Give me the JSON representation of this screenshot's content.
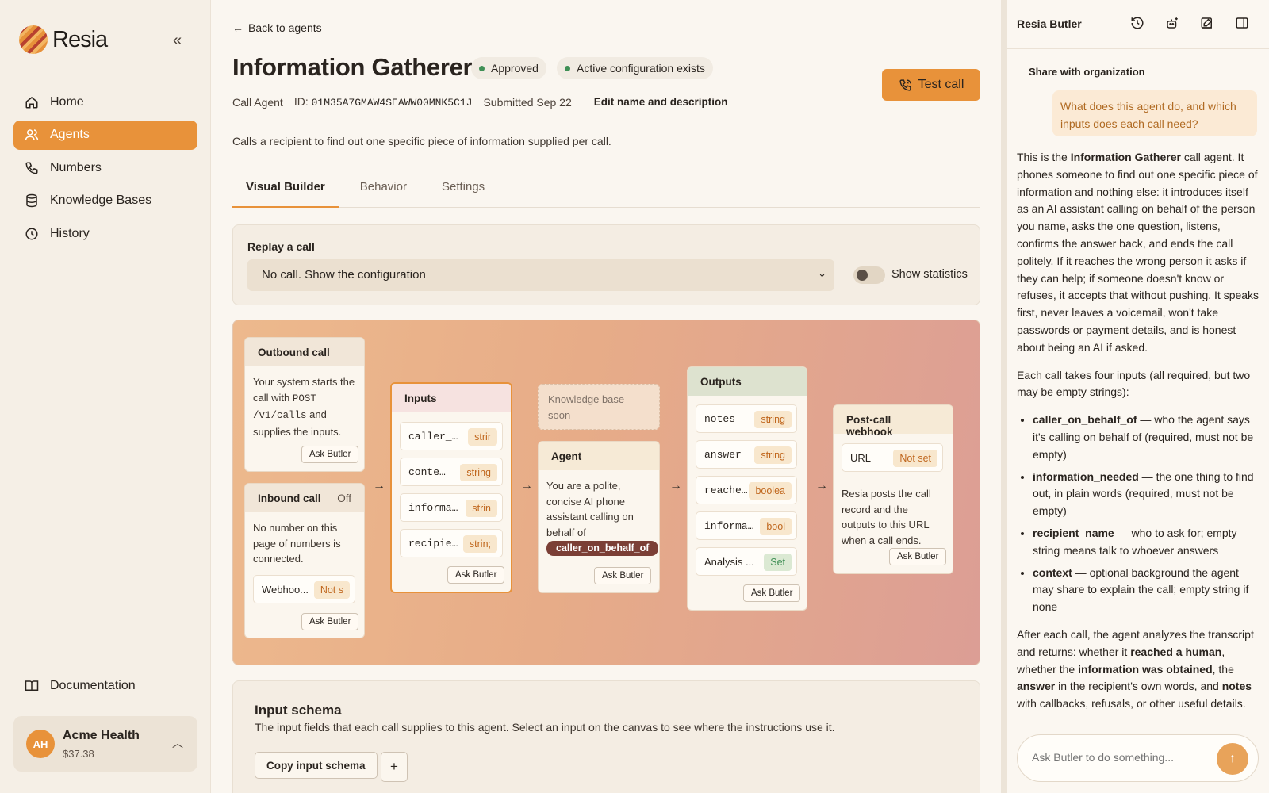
{
  "brand": {
    "name": "Resia"
  },
  "sidebar": {
    "items": [
      {
        "label": "Home",
        "active": false
      },
      {
        "label": "Agents",
        "active": true
      },
      {
        "label": "Numbers",
        "active": false
      },
      {
        "label": "Knowledge Bases",
        "active": false
      },
      {
        "label": "History",
        "active": false
      }
    ],
    "documentation": "Documentation",
    "account": {
      "initials": "AH",
      "name": "Acme Health",
      "balance": "$37.38"
    }
  },
  "header": {
    "back": "Back to agents",
    "title": "Information Gatherer",
    "badges": [
      "Approved",
      "Active configuration exists"
    ],
    "meta": {
      "type": "Call Agent",
      "id_label": "ID:",
      "id": "01M35A7GMAW4SEAWW00MNK5C1J",
      "submitted": "Submitted Sep 22",
      "edit": "Edit name and description"
    },
    "test_call": "Test call",
    "description": "Calls a recipient to find out one specific piece of information supplied per call."
  },
  "tabs": [
    "Visual Builder",
    "Behavior",
    "Settings"
  ],
  "replay": {
    "label": "Replay a call",
    "selected": "No call. Show the configuration",
    "toggle_label": "Show statistics"
  },
  "canvas": {
    "ask": "Ask Butler",
    "outbound": {
      "title": "Outbound call",
      "text_1": "Your system starts the call with ",
      "code_1": "POST",
      "code_2": "/v1/calls",
      "text_2": " and supplies the inputs."
    },
    "inbound": {
      "title": "Inbound call",
      "status": "Off",
      "text": "No number on this page of numbers is connected.",
      "field_name": "Webhoo...",
      "field_type": "Not s"
    },
    "inputs": {
      "title": "Inputs",
      "fields": [
        {
          "name": "caller_…",
          "type": "strir"
        },
        {
          "name": "conte…",
          "type": "string"
        },
        {
          "name": "informa…",
          "type": "strin"
        },
        {
          "name": "recipie…",
          "type": "strin;"
        }
      ]
    },
    "kb": {
      "text": "Knowledge base — soon"
    },
    "agent": {
      "title": "Agent",
      "text": "You are a polite, concise AI phone assistant calling on behalf of",
      "var": "caller_on_behalf_of"
    },
    "outputs": {
      "title": "Outputs",
      "fields": [
        {
          "name": "notes",
          "type": "string"
        },
        {
          "name": "answer",
          "type": "string"
        },
        {
          "name": "reache…",
          "type": "boolea"
        },
        {
          "name": "informa…",
          "type": "bool"
        },
        {
          "name": "Analysis ...",
          "type": "Set"
        }
      ]
    },
    "webhook": {
      "title": "Post-call webhook",
      "field_name": "URL",
      "field_type": "Not set",
      "text": "Resia posts the call record and the outputs to this URL when a call ends."
    }
  },
  "schema": {
    "title": "Input schema",
    "desc": "The input fields that each call supplies to this agent. Select an input on the canvas to see where the instructions use it.",
    "copy": "Copy input schema",
    "plus": "+"
  },
  "butler": {
    "title": "Resia Butler",
    "share": "Share with organization",
    "question": "What does this agent do, and which inputs does each call need?",
    "p1": {
      "a": "This is the ",
      "b": "Information Gatherer",
      "c": " call agent. It phones someone to find out one specific piece of information and nothing else: it introduces itself as an AI assistant calling on behalf of the person you name, asks the one question, listens, confirms the answer back, and ends the call politely. If it reaches the wrong person it asks if they can help; if someone doesn't know or refuses, it accepts that without pushing. It speaks first, never leaves a voicemail, won't take passwords or payment details, and is honest about being an AI if asked."
    },
    "p2": "Each call takes four inputs (all required, but two may be empty strings):",
    "bullets": [
      {
        "term": "caller_on_behalf_of",
        "text": " — who the agent says it's calling on behalf of (required, must not be empty)"
      },
      {
        "term": "information_needed",
        "text": " — the one thing to find out, in plain words (required, must not be empty)"
      },
      {
        "term": "recipient_name",
        "text": " — who to ask for; empty string means talk to whoever answers"
      },
      {
        "term": "context",
        "text": " — optional background the agent may share to explain the call; empty string if none"
      }
    ],
    "p3": {
      "a": "After each call, the agent analyzes the transcript and returns: whether it ",
      "b": "reached a human",
      "c": ", whether the ",
      "d": "information was obtained",
      "e": ", the ",
      "f": "answer",
      "g": " in the recipient's own words, and ",
      "h": "notes",
      "i": " with callbacks, refusals, or other useful details."
    },
    "composer_placeholder": "Ask Butler to do something..."
  }
}
